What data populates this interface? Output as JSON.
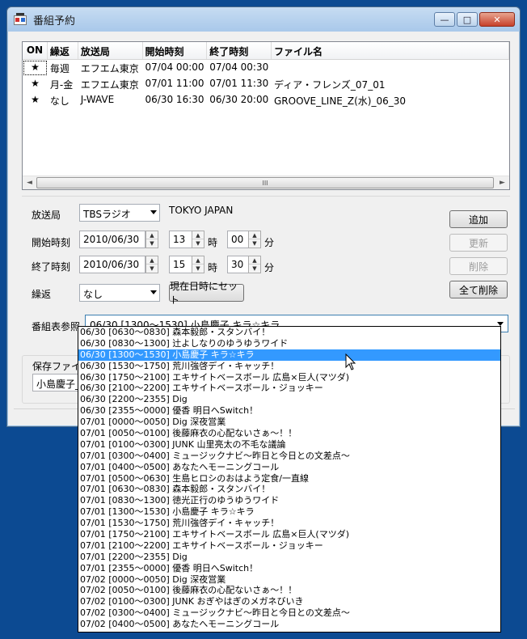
{
  "window": {
    "title": "番組予約",
    "min_label": "—",
    "max_label": "□",
    "close_label": "✕"
  },
  "table": {
    "headers": [
      "ON",
      "繰返",
      "放送局",
      "開始時刻",
      "終了時刻",
      "ファイル名"
    ],
    "rows": [
      [
        "★",
        "毎週",
        "エフエム東京",
        "07/04 00:00",
        "07/04 00:30",
        ""
      ],
      [
        "★",
        "月-金",
        "エフエム東京",
        "07/01 11:00",
        "07/01 11:30",
        "ディア・フレンズ_07_01"
      ],
      [
        "★",
        "なし",
        "J-WAVE",
        "06/30 16:30",
        "06/30 20:00",
        "GROOVE_LINE_Z(水)_06_30"
      ]
    ],
    "scroll_left": "◄",
    "scroll_right": "►",
    "scroll_grip": "III"
  },
  "form": {
    "station_label": "放送局",
    "station_value": "TBSラジオ",
    "station_info": "TOKYO JAPAN",
    "start_label": "開始時刻",
    "start_date": "2010/06/30",
    "start_hour": "13",
    "start_min": "00",
    "end_label": "終了時刻",
    "end_date": "2010/06/30",
    "end_hour": "15",
    "end_min": "30",
    "hour_unit": "時",
    "min_unit": "分",
    "repeat_label": "繰返",
    "repeat_value": "なし",
    "set_now_button": "現在日時にセット",
    "add_button": "追加",
    "update_button": "更新",
    "delete_button": "削除",
    "delete_all_button": "全て削除",
    "program_label": "番組表参照",
    "program_value": "06/30 [1300〜1530] 小島慶子 キラ☆キラ",
    "save_group_label": "保存ファイル名",
    "save_file_value": "小島慶子_キ",
    "spin_up": "▲",
    "spin_down": "▼"
  },
  "dropdown": {
    "selected_index": 2,
    "items": [
      "06/30 [0630〜0830] 森本毅郎・スタンバイ！",
      "06/30 [0830〜1300] 辻よしなりのゆうゆうワイド",
      "06/30 [1300〜1530] 小島慶子 キラ☆キラ",
      "06/30 [1530〜1750] 荒川強啓デイ・キャッチ！",
      "06/30 [1750〜2100] エキサイトベースボール 広島×巨人(マツダ)",
      "06/30 [2100〜2200] エキサイトベースボール・ジョッキー",
      "06/30 [2200〜2355] Dig",
      "06/30 [2355〜0000] 優香 明日へSwitch！",
      "07/01 [0000〜0050] Dig 深夜営業",
      "07/01 [0050〜0100] 後藤麻衣の心配ないさぁ〜！！",
      "07/01 [0100〜0300] JUNK 山里亮太の不毛な議論",
      "07/01 [0300〜0400] ミュージックナビ〜昨日と今日との文差点〜",
      "07/01 [0400〜0500] あなたへモーニングコール",
      "07/01 [0500〜0630] 生島ヒロシのおはよう定食/一直線",
      "07/01 [0630〜0830] 森本毅郎・スタンバイ！",
      "07/01 [0830〜1300] 徳光正行のゆうゆうワイド",
      "07/01 [1300〜1530] 小島慶子 キラ☆キラ",
      "07/01 [1530〜1750] 荒川強啓デイ・キャッチ！",
      "07/01 [1750〜2100] エキサイトベースボール 広島×巨人(マツダ)",
      "07/01 [2100〜2200] エキサイトベースボール・ジョッキー",
      "07/01 [2200〜2355] Dig",
      "07/01 [2355〜0000] 優香 明日へSwitch！",
      "07/02 [0000〜0050] Dig 深夜営業",
      "07/02 [0050〜0100] 後藤麻衣の心配ないさぁ〜！！",
      "07/02 [0100〜0300] JUNK おぎやはぎのメガネびいき",
      "07/02 [0300〜0400] ミュージックナビ〜昨日と今日との文差点〜",
      "07/02 [0400〜0500] あなたへモーニングコール"
    ]
  }
}
